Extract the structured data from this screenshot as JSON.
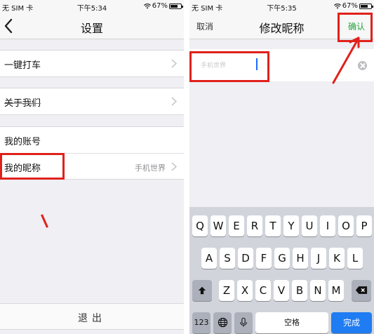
{
  "left": {
    "status": {
      "carrier": "无 SIM 卡",
      "time": "下午5:34",
      "battery": "67%"
    },
    "nav_title": "设置",
    "items": {
      "carpool": "一键打车",
      "about": "关于我们",
      "account": "我的账号",
      "nickname": "我的昵称",
      "nickname_value": "手机世界"
    },
    "logout": "退出"
  },
  "right": {
    "status": {
      "carrier": "无 SIM 卡",
      "time": "下午5:35",
      "battery": "67%"
    },
    "nav_cancel": "取消",
    "nav_title": "修改昵称",
    "nav_confirm": "确认",
    "input_value": "手机世界"
  },
  "keyboard": {
    "row1": [
      "Q",
      "W",
      "E",
      "R",
      "T",
      "Y",
      "U",
      "I",
      "O",
      "P"
    ],
    "row2": [
      "A",
      "S",
      "D",
      "F",
      "G",
      "H",
      "J",
      "K",
      "L"
    ],
    "row3": [
      "Z",
      "X",
      "C",
      "V",
      "B",
      "N",
      "M"
    ],
    "numbers_key": "123",
    "space_key": "空格",
    "done_key": "完成"
  },
  "icons": {
    "back": "chevron-left-icon",
    "chevron": "chevron-right-icon",
    "clear": "clear-circle-icon",
    "shift": "shift-icon",
    "delete": "backspace-icon",
    "globe": "globe-icon",
    "mic": "microphone-icon",
    "wifi": "wifi-icon",
    "battery": "battery-icon"
  },
  "colors": {
    "confirm_green": "#22a33b",
    "highlight_red": "#e0211b",
    "done_blue": "#1f7cf2"
  }
}
